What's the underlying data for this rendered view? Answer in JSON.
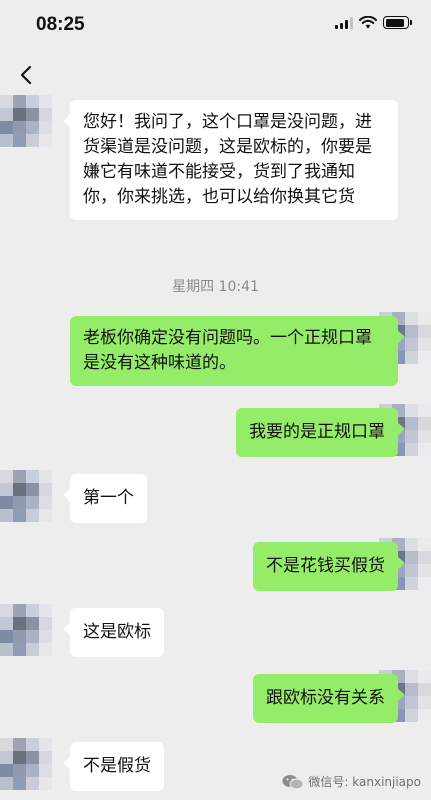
{
  "status_bar": {
    "time": "08:25",
    "signal_icon": "signal-bars-icon",
    "wifi_icon": "wifi-icon",
    "battery_icon": "battery-icon",
    "battery_level": 0.9
  },
  "nav": {
    "back_icon": "chevron-left-icon"
  },
  "chat": {
    "messages": [
      {
        "side": "in",
        "text": "您好！我问了，这个口罩是没问题，进货渠道是没问题，这是欧标的，你要是嫌它有味道不能接受，货到了我通知你，你来挑选，也可以给你换其它货"
      },
      {
        "side": "out",
        "text": "老板你确定没有问题吗。一个正规口罩是没有这种味道的。"
      },
      {
        "side": "out",
        "text": "我要的是正规口罩"
      },
      {
        "side": "in",
        "text": "第一个"
      },
      {
        "side": "out",
        "text": "不是花钱买假货"
      },
      {
        "side": "in",
        "text": "这是欧标"
      },
      {
        "side": "out",
        "text": "跟欧标没有关系"
      },
      {
        "side": "in",
        "text": "不是假货"
      }
    ],
    "timestamp": "星期四 10:41"
  },
  "watermark": {
    "text": "微信号: kanxinjiapo",
    "icon": "wechat-icon"
  },
  "colors": {
    "background": "#ededed",
    "incoming_bubble": "#ffffff",
    "outgoing_bubble": "#95ec69"
  }
}
